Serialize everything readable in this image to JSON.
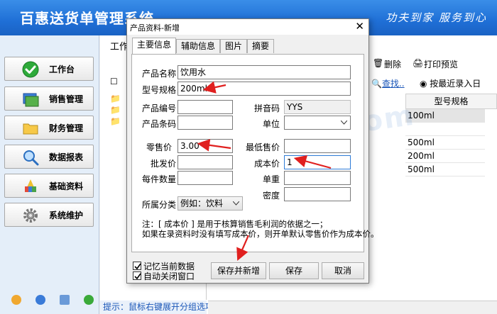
{
  "app": {
    "title": "百惠送货单管理系统",
    "slogan": "功夫到家 服务到心"
  },
  "nav": {
    "items": [
      {
        "label": "工作台"
      },
      {
        "label": "销售管理"
      },
      {
        "label": "财务管理"
      },
      {
        "label": "数据报表"
      },
      {
        "label": "基础资料"
      },
      {
        "label": "系统维护"
      }
    ]
  },
  "workspace": {
    "tab_label": "工作",
    "hint": "提示：鼠标右键展开分组选项",
    "toolbar": {
      "delete_label": "删除",
      "print_label": "打印预览"
    },
    "search_label": "查找..",
    "sort_option": "按最近录入日",
    "grid": {
      "column_header": "型号规格",
      "rows": [
        "100ml",
        "",
        "500ml",
        "200ml",
        "500ml"
      ]
    }
  },
  "dialog": {
    "title": "产品资料-新增",
    "close_glyph": "✕",
    "tabs": [
      "主要信息",
      "辅助信息",
      "图片",
      "摘要"
    ],
    "labels": {
      "name": "产品名称",
      "spec": "型号规格",
      "code": "产品编号",
      "pinyin": "拼音码",
      "barcode": "产品条码",
      "unit": "单位",
      "retail": "零售价",
      "min_price": "最低售价",
      "wholesale": "批发价",
      "cost": "成本价",
      "per_pack": "每件数量",
      "weight": "单重",
      "density": "密度",
      "category": "所属分类"
    },
    "values": {
      "name": "饮用水",
      "spec": "200ml",
      "code": "",
      "pinyin": "YYS",
      "barcode": "",
      "unit": "",
      "retail": "3.00",
      "min_price": "",
      "wholesale": "",
      "cost": "1",
      "per_pack": "",
      "weight": "",
      "density": "",
      "category": "例如：饮料"
    },
    "note_line1": "注：[ 成本价 ] 是用于核算销售毛利润的依据之一；",
    "note_line2": "如果在录资料时没有填写成本价，则开单默认零售价作为成本价。",
    "checkboxes": [
      {
        "label": "记忆当前数据",
        "checked": true
      },
      {
        "label": "自动关闭窗口",
        "checked": true
      }
    ],
    "buttons": {
      "save_new": "保存并新增",
      "save": "保存",
      "cancel": "取消"
    }
  },
  "watermark": "haoded.com",
  "colors": {
    "header_blue": "#1f6fd6",
    "arrow_red": "#e0201f",
    "link_blue": "#1a56b8"
  }
}
